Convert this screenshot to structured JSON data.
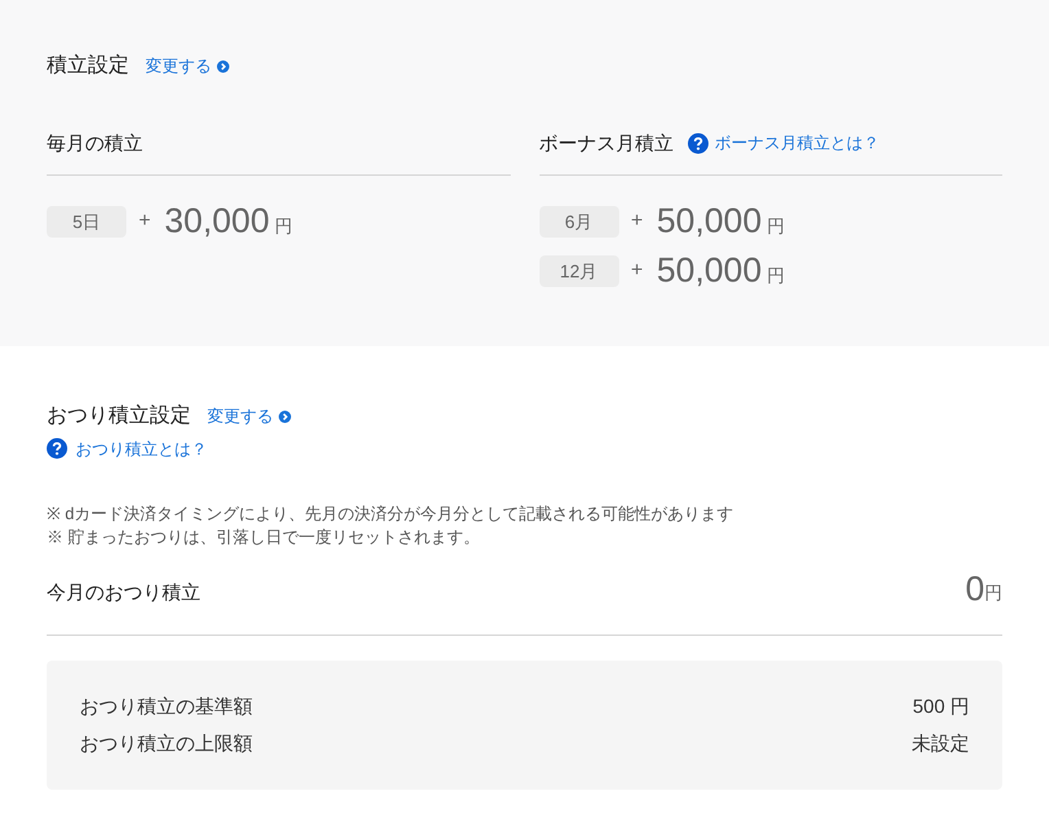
{
  "savings": {
    "title": "積立設定",
    "change_link": "変更する",
    "monthly": {
      "heading": "毎月の積立",
      "rows": [
        {
          "tag": "5日",
          "plus": "+",
          "amount": "30,000",
          "unit": "円"
        }
      ]
    },
    "bonus": {
      "heading": "ボーナス月積立",
      "help_link": "ボーナス月積立とは？",
      "rows": [
        {
          "tag": "6月",
          "plus": "+",
          "amount": "50,000",
          "unit": "円"
        },
        {
          "tag": "12月",
          "plus": "+",
          "amount": "50,000",
          "unit": "円"
        }
      ]
    }
  },
  "change_savings": {
    "title": "おつり積立設定",
    "change_link": "変更する",
    "help_link": "おつり積立とは？",
    "notes": [
      "※ dカード決済タイミングにより、先月の決済分が今月分として記載される可能性があります",
      "※ 貯まったおつりは、引落し日で一度リセットされます。"
    ],
    "current": {
      "label": "今月のおつり積立",
      "amount": "0",
      "unit": "円"
    },
    "settings": [
      {
        "label": "おつり積立の基準額",
        "value": "500 円"
      },
      {
        "label": "おつり積立の上限額",
        "value": "未設定"
      }
    ]
  }
}
